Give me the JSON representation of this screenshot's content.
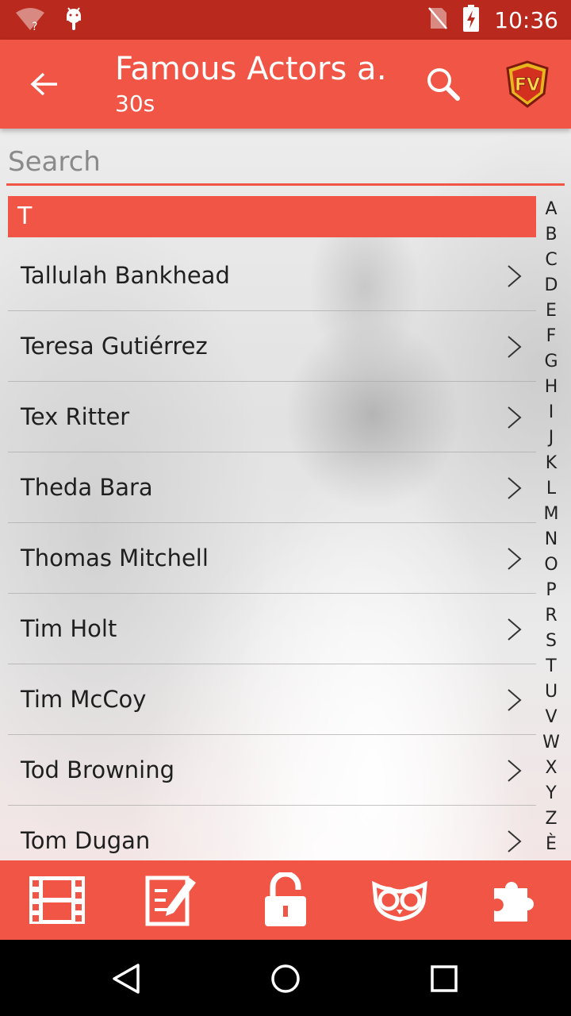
{
  "status_bar": {
    "time": "10:36",
    "icons": [
      "wifi-unknown-icon",
      "android-debug-icon",
      "no-sim-icon",
      "battery-charging-icon"
    ]
  },
  "app_bar": {
    "title": "Famous Actors a…",
    "subtitle": "30s",
    "icons": [
      "back-arrow-icon",
      "search-icon",
      "fv-logo"
    ],
    "logo_text": "FV"
  },
  "search": {
    "placeholder": "Search",
    "value": ""
  },
  "section_header": "T",
  "actors": [
    {
      "name": "Tallulah Bankhead"
    },
    {
      "name": "Teresa Gutiérrez"
    },
    {
      "name": "Tex Ritter"
    },
    {
      "name": "Theda Bara"
    },
    {
      "name": "Thomas Mitchell"
    },
    {
      "name": "Tim Holt"
    },
    {
      "name": "Tim McCoy"
    },
    {
      "name": "Tod Browning"
    },
    {
      "name": "Tom Dugan"
    }
  ],
  "alphabet_index": [
    "A",
    "B",
    "C",
    "D",
    "E",
    "F",
    "G",
    "H",
    "I",
    "J",
    "K",
    "L",
    "M",
    "N",
    "O",
    "P",
    "R",
    "S",
    "T",
    "U",
    "V",
    "W",
    "X",
    "Y",
    "Z",
    "È"
  ],
  "bottom_toolbar": [
    "film-strip-icon",
    "edit-note-icon",
    "unlock-icon",
    "owl-icon",
    "puzzle-icon"
  ],
  "nav_bar": [
    "back-triangle-icon",
    "home-circle-icon",
    "recents-square-icon"
  ],
  "colors": {
    "accent": "#f05545",
    "status_bar": "#b9291d"
  }
}
